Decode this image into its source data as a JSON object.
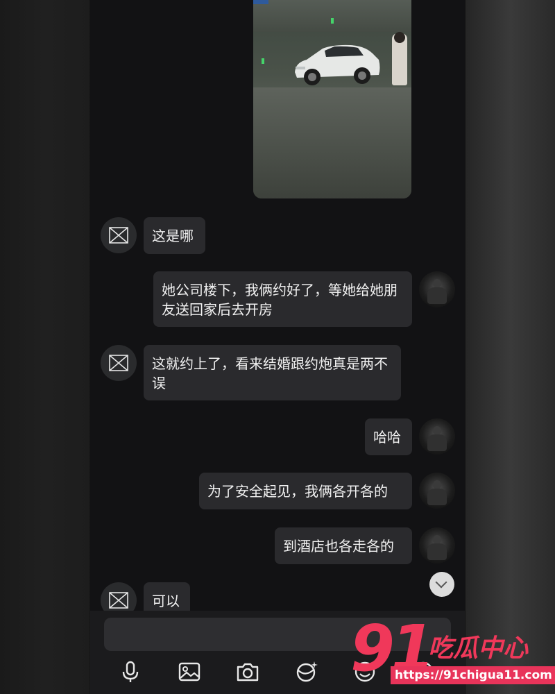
{
  "colors": {
    "background": "#121214",
    "bubble": "#2a2a2d",
    "text": "#f2f2f2",
    "composer": "#1b1b1d",
    "watermark": "#f0385a"
  },
  "chat": {
    "media_preview": {
      "kind": "photo",
      "icons": [
        "parking-sign-icon"
      ]
    },
    "messages": [
      {
        "from": "other",
        "text": "这是哪"
      },
      {
        "from": "self",
        "text": "她公司楼下，我俩约好了，等她给她朋友送回家后去开房"
      },
      {
        "from": "other",
        "text": "这就约上了，看来结婚跟约炮真是两不误"
      },
      {
        "from": "self",
        "text": "哈哈"
      },
      {
        "from": "self",
        "text": "为了安全起见，我俩各开各的"
      },
      {
        "from": "self",
        "text": "到酒店也各走各的"
      },
      {
        "from": "other",
        "text": "可以"
      }
    ]
  },
  "composer": {
    "input_value": "",
    "tools": [
      "microphone-icon",
      "image-icon",
      "camera-icon",
      "sticker-icon",
      "emoji-icon",
      "add-icon"
    ]
  },
  "watermark": {
    "number": "91",
    "name": "吃瓜中心",
    "url": "https://91chigua11.com"
  }
}
